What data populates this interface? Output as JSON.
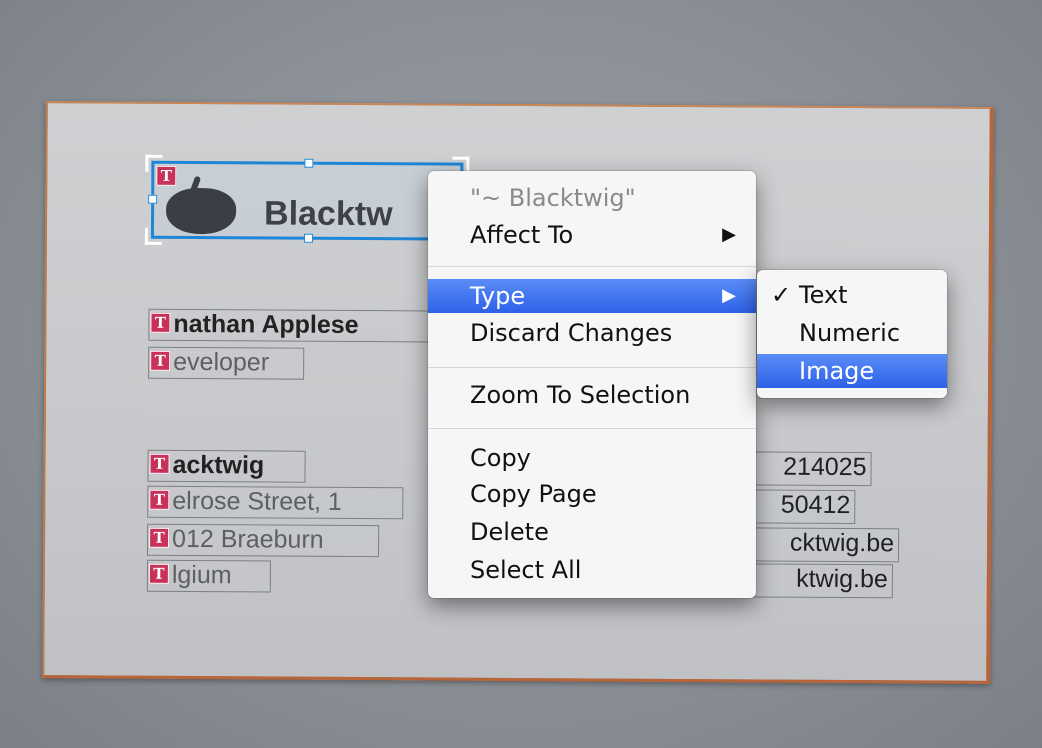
{
  "card": {
    "logo_text": "Blacktw",
    "name": "nathan Applese",
    "role": "eveloper",
    "company": "acktwig",
    "street": "elrose Street, 1",
    "city": "012 Braeburn",
    "country": "lgium",
    "phone1": "214025",
    "phone2": "50412",
    "email": "cktwig.be",
    "web": "ktwig.be",
    "badge_letter": "T"
  },
  "context_menu": {
    "header": "\"~ Blacktwig\"",
    "items": [
      {
        "label": "Affect To",
        "submenu": true
      },
      {
        "label": "Type",
        "submenu": true,
        "highlighted": true
      },
      {
        "label": "Discard Changes"
      },
      {
        "label": "Zoom To Selection"
      },
      {
        "label": "Copy"
      },
      {
        "label": "Copy Page"
      },
      {
        "label": "Delete"
      },
      {
        "label": "Select All"
      }
    ],
    "arrow_glyph": "▶"
  },
  "type_submenu": {
    "items": [
      {
        "label": "Text",
        "checked": true
      },
      {
        "label": "Numeric"
      },
      {
        "label": "Image",
        "highlighted": true
      }
    ],
    "check_glyph": "✓"
  },
  "colors": {
    "selection": "#1e86d6",
    "highlight": "#3a6ff0",
    "badge": "#c8325a",
    "card_edge": "#b9653a"
  }
}
